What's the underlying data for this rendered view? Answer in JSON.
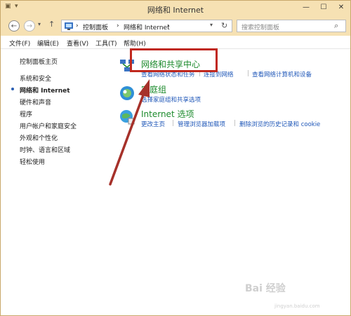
{
  "window": {
    "title": "网络和 Internet"
  },
  "address": {
    "crumbs": [
      "控制面板",
      "网络和 Internet"
    ],
    "search_placeholder": "搜索控制面板"
  },
  "menubar": [
    "文件(F)",
    "编辑(E)",
    "查看(V)",
    "工具(T)",
    "帮助(H)"
  ],
  "sidebar": {
    "items": [
      "控制面板主页",
      "系统和安全",
      "网络和 Internet",
      "硬件和声音",
      "程序",
      "用户帐户和家庭安全",
      "外观和个性化",
      "时钟、语言和区域",
      "轻松使用"
    ]
  },
  "categories": [
    {
      "title": "网络和共享中心",
      "links": [
        "查看网络状态和任务",
        "连接到网络",
        "查看网络计算机和设备"
      ]
    },
    {
      "title": "家庭组",
      "links": [
        "选择家庭组和共享选项"
      ]
    },
    {
      "title": "Internet 选项",
      "links": [
        "更改主页",
        "管理浏览器加载项",
        "删除浏览的历史记录和 cookie"
      ]
    }
  ],
  "watermark": "Bai 经验",
  "watermark_sub": "jingyan.baidu.com"
}
